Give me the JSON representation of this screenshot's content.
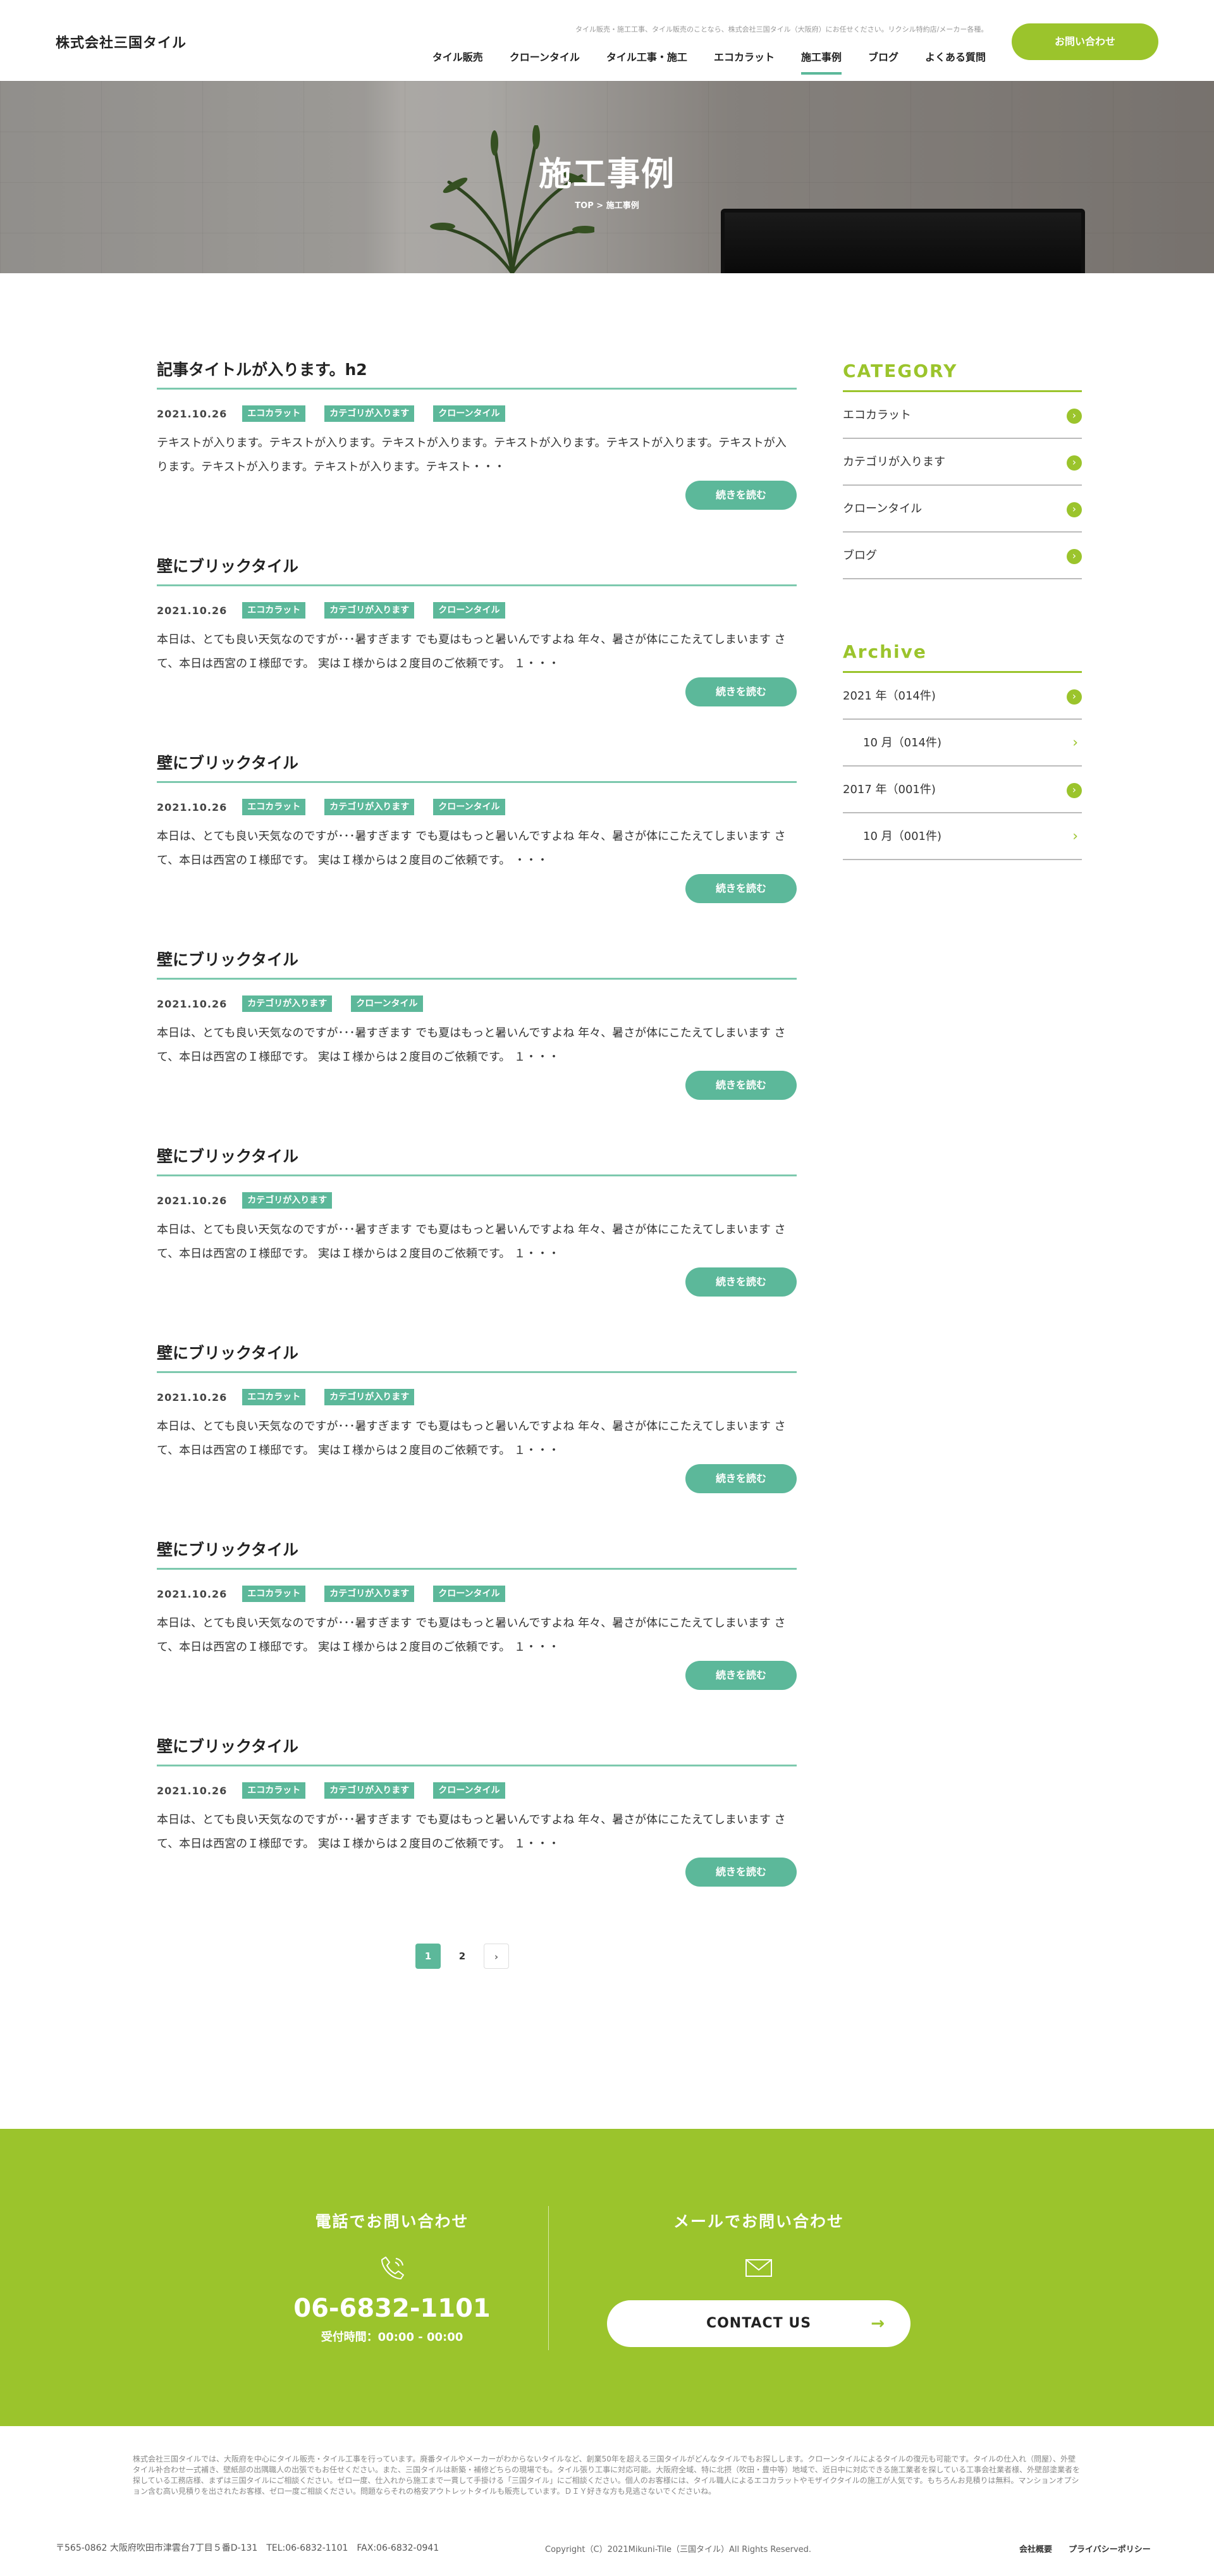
{
  "header": {
    "logo": "株式会社三国タイル",
    "tagline": "タイル販売・施工工事、タイル販売のことなら、株式会社三国タイル（大阪府）にお任せください。リクシル特約店/メーカー各種。",
    "nav": [
      "タイル販売",
      "クローンタイル",
      "タイル工事・施工",
      "エコカラット",
      "施工事例",
      "ブログ",
      "よくある質問"
    ],
    "nav_active": "施工事例",
    "cta": "お問い合わせ"
  },
  "hero": {
    "title": "施工事例",
    "breadcrumb": "TOP > 施工事例"
  },
  "posts": [
    {
      "title": "記事タイトルが入ります。h2",
      "date": "2021.10.26",
      "tags": [
        "エコカラット",
        "カテゴリが入ります",
        "クローンタイル"
      ],
      "excerpt": "テキストが入ります。テキストが入ります。テキストが入ります。テキストが入ります。テキストが入ります。テキストが入ります。テキストが入ります。テキストが入ります。テキスト・・・",
      "more": "続きを読む"
    },
    {
      "title": "壁にブリックタイル",
      "date": "2021.10.26",
      "tags": [
        "エコカラット",
        "カテゴリが入ります",
        "クローンタイル"
      ],
      "excerpt": "本日は、とても良い天気なのですが･･･暑すぎます でも夏はもっと暑いんですよね 年々、暑さが体にこたえてしまいます さて、本日は西宮のＩ様邸です。 実はＩ様からは２度目のご依頼です。 １・・・",
      "more": "続きを読む"
    },
    {
      "title": "壁にブリックタイル",
      "date": "2021.10.26",
      "tags": [
        "エコカラット",
        "カテゴリが入ります",
        "クローンタイル"
      ],
      "excerpt": "本日は、とても良い天気なのですが･･･暑すぎます でも夏はもっと暑いんですよね 年々、暑さが体にこたえてしまいます さて、本日は西宮のＩ様邸です。 実はＩ様からは２度目のご依頼です。 ・・・",
      "more": "続きを読む"
    },
    {
      "title": "壁にブリックタイル",
      "date": "2021.10.26",
      "tags": [
        "カテゴリが入ります",
        "クローンタイル"
      ],
      "excerpt": "本日は、とても良い天気なのですが･･･暑すぎます でも夏はもっと暑いんですよね 年々、暑さが体にこたえてしまいます さて、本日は西宮のＩ様邸です。 実はＩ様からは２度目のご依頼です。 １・・・",
      "more": "続きを読む"
    },
    {
      "title": "壁にブリックタイル",
      "date": "2021.10.26",
      "tags": [
        "カテゴリが入ります"
      ],
      "excerpt": "本日は、とても良い天気なのですが･･･暑すぎます でも夏はもっと暑いんですよね 年々、暑さが体にこたえてしまいます さて、本日は西宮のＩ様邸です。 実はＩ様からは２度目のご依頼です。 １・・・",
      "more": "続きを読む"
    },
    {
      "title": "壁にブリックタイル",
      "date": "2021.10.26",
      "tags": [
        "エコカラット",
        "カテゴリが入ります"
      ],
      "excerpt": "本日は、とても良い天気なのですが･･･暑すぎます でも夏はもっと暑いんですよね 年々、暑さが体にこたえてしまいます さて、本日は西宮のＩ様邸です。 実はＩ様からは２度目のご依頼です。 １・・・",
      "more": "続きを読む"
    },
    {
      "title": "壁にブリックタイル",
      "date": "2021.10.26",
      "tags": [
        "エコカラット",
        "カテゴリが入ります",
        "クローンタイル"
      ],
      "excerpt": "本日は、とても良い天気なのですが･･･暑すぎます でも夏はもっと暑いんですよね 年々、暑さが体にこたえてしまいます さて、本日は西宮のＩ様邸です。 実はＩ様からは２度目のご依頼です。 １・・・",
      "more": "続きを読む"
    },
    {
      "title": "壁にブリックタイル",
      "date": "2021.10.26",
      "tags": [
        "エコカラット",
        "カテゴリが入ります",
        "クローンタイル"
      ],
      "excerpt": "本日は、とても良い天気なのですが･･･暑すぎます でも夏はもっと暑いんですよね 年々、暑さが体にこたえてしまいます さて、本日は西宮のＩ様邸です。 実はＩ様からは２度目のご依頼です。 １・・・",
      "more": "続きを読む"
    }
  ],
  "pagination": {
    "pages": [
      "1",
      "2"
    ],
    "current": "1",
    "next": "›"
  },
  "sidebar": {
    "category_heading": "CATEGORY",
    "categories": [
      "エコカラット",
      "カテゴリが入ります",
      "クローンタイル",
      "ブログ"
    ],
    "archive_heading": "Archive",
    "archive": [
      {
        "label": "2021 年（014件)",
        "level": "year"
      },
      {
        "label": "10 月（014件)",
        "level": "month"
      },
      {
        "label": "2017 年（001件)",
        "level": "year"
      },
      {
        "label": "10 月（001件)",
        "level": "month"
      }
    ]
  },
  "contact": {
    "phone_heading": "電話でお問い合わせ",
    "phone": "06-6832-1101",
    "hours": "受付時間：00:00 - 00:00",
    "mail_heading": "メールでお問い合わせ",
    "button": "CONTACT US",
    "button_arrow": "→"
  },
  "footer": {
    "description": "株式会社三国タイルでは、大阪府を中心にタイル販売・タイル工事を行っています。廃番タイルやメーカーがわからないタイルなど、創業50年を超える三国タイルがどんなタイルでもお探しします。クローンタイルによるタイルの復元も可能です。タイルの仕入れ（問屋）、外壁タイル补合わせ一式補き、壁紙部の出隅職人の出張でもお任せください。また、三国タイルは新築・補修どちらの現場でも。タイル張り工事に対応可能。大阪府全域、特に北摂（吹田・豊中等）地域で、近日中に対応できる施工業者を探している工事会社業者様、外壁部塗業者を探している工務店様、まずは三国タイルにご相談ください。ゼロ一度、仕入れから施工まで一貫して手掛ける「三国タイル」にご相談ください。個人のお客様には、タイル職人によるエコカラットやモザイクタイルの施工が人気です。もちろんお見積りは無料。マンションオプション含む高い見積りを出されたお客様、ゼロ一度ご相談ください。問題ならそれの格安アウトレットタイルも販売しています。ＤＩＹ好きな方も見逃さないでくださいね。",
    "address": "〒565-0862 大阪府吹田市津雲台7丁目５番D-131　TEL:06-6832-1101　FAX:06-6832-0941",
    "copyright": "Copyright（C）2021Mikuni-Tile（三国タイル）All Rights Reserved.",
    "links": [
      "会社概要",
      "プライバシーポリシー"
    ]
  },
  "colors": {
    "green": "#5cb89a",
    "lime": "#9bc42c"
  }
}
